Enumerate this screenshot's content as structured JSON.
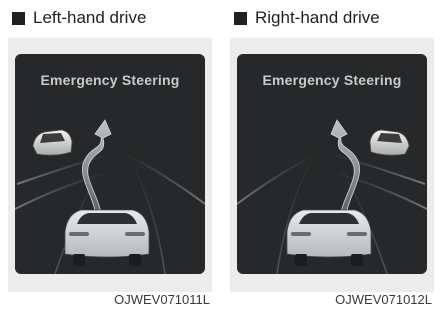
{
  "panels": [
    {
      "heading": "Left-hand drive",
      "display_title": "Emergency Steering",
      "image_code": "OJWEV071011L",
      "icons": [
        "square-bullet-icon",
        "obstacle-vehicle-icon",
        "steering-path-arrow-icon",
        "own-vehicle-icon"
      ]
    },
    {
      "heading": "Right-hand drive",
      "display_title": "Emergency Steering",
      "image_code": "OJWEV071012L",
      "icons": [
        "square-bullet-icon",
        "obstacle-vehicle-icon",
        "steering-path-arrow-icon",
        "own-vehicle-icon"
      ]
    }
  ],
  "colors": {
    "screen_background": "#262829",
    "display_text": "#c9cacb",
    "frame_background": "#ececec"
  }
}
